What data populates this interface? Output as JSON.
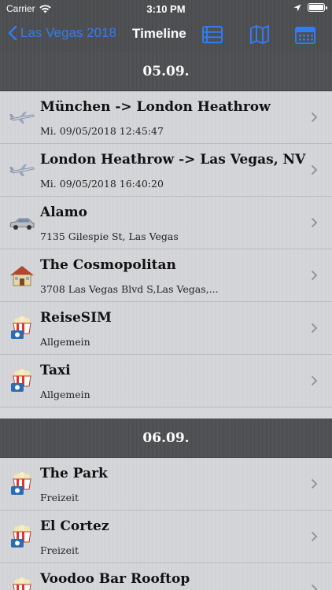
{
  "status": {
    "carrier": "Carrier",
    "time": "3:10 PM"
  },
  "nav": {
    "back_label": "Las Vegas 2018",
    "title": "Timeline"
  },
  "colors": {
    "accent": "#2f7cf6",
    "header_bg": "#4d4e51",
    "row_bg": "#d3d4d7"
  },
  "sections": [
    {
      "header": "05.09.",
      "items": [
        {
          "icon": "airplane-icon",
          "title": "München -> London Heathrow",
          "subtitle": "Mi. 09/05/2018 12:45:47"
        },
        {
          "icon": "airplane-icon",
          "title": "London Heathrow -> Las Vegas, NV",
          "subtitle": "Mi. 09/05/2018 16:40:20"
        },
        {
          "icon": "car-icon",
          "title": "Alamo",
          "subtitle": "7135 Gilespie St, Las Vegas"
        },
        {
          "icon": "house-icon",
          "title": "The Cosmopolitan",
          "subtitle": "3708 Las Vegas Blvd S,Las Vegas,..."
        },
        {
          "icon": "cinema-icon",
          "title": "ReiseSIM",
          "subtitle": "Allgemein"
        },
        {
          "icon": "cinema-icon",
          "title": "Taxi",
          "subtitle": "Allgemein"
        }
      ]
    },
    {
      "header": "06.09.",
      "items": [
        {
          "icon": "cinema-icon",
          "title": "The Park",
          "subtitle": "Freizeit"
        },
        {
          "icon": "cinema-icon",
          "title": "El Cortez",
          "subtitle": "Freizeit"
        },
        {
          "icon": "cinema-icon",
          "title": "Voodoo Bar Rooftop",
          "subtitle": ""
        }
      ]
    }
  ]
}
